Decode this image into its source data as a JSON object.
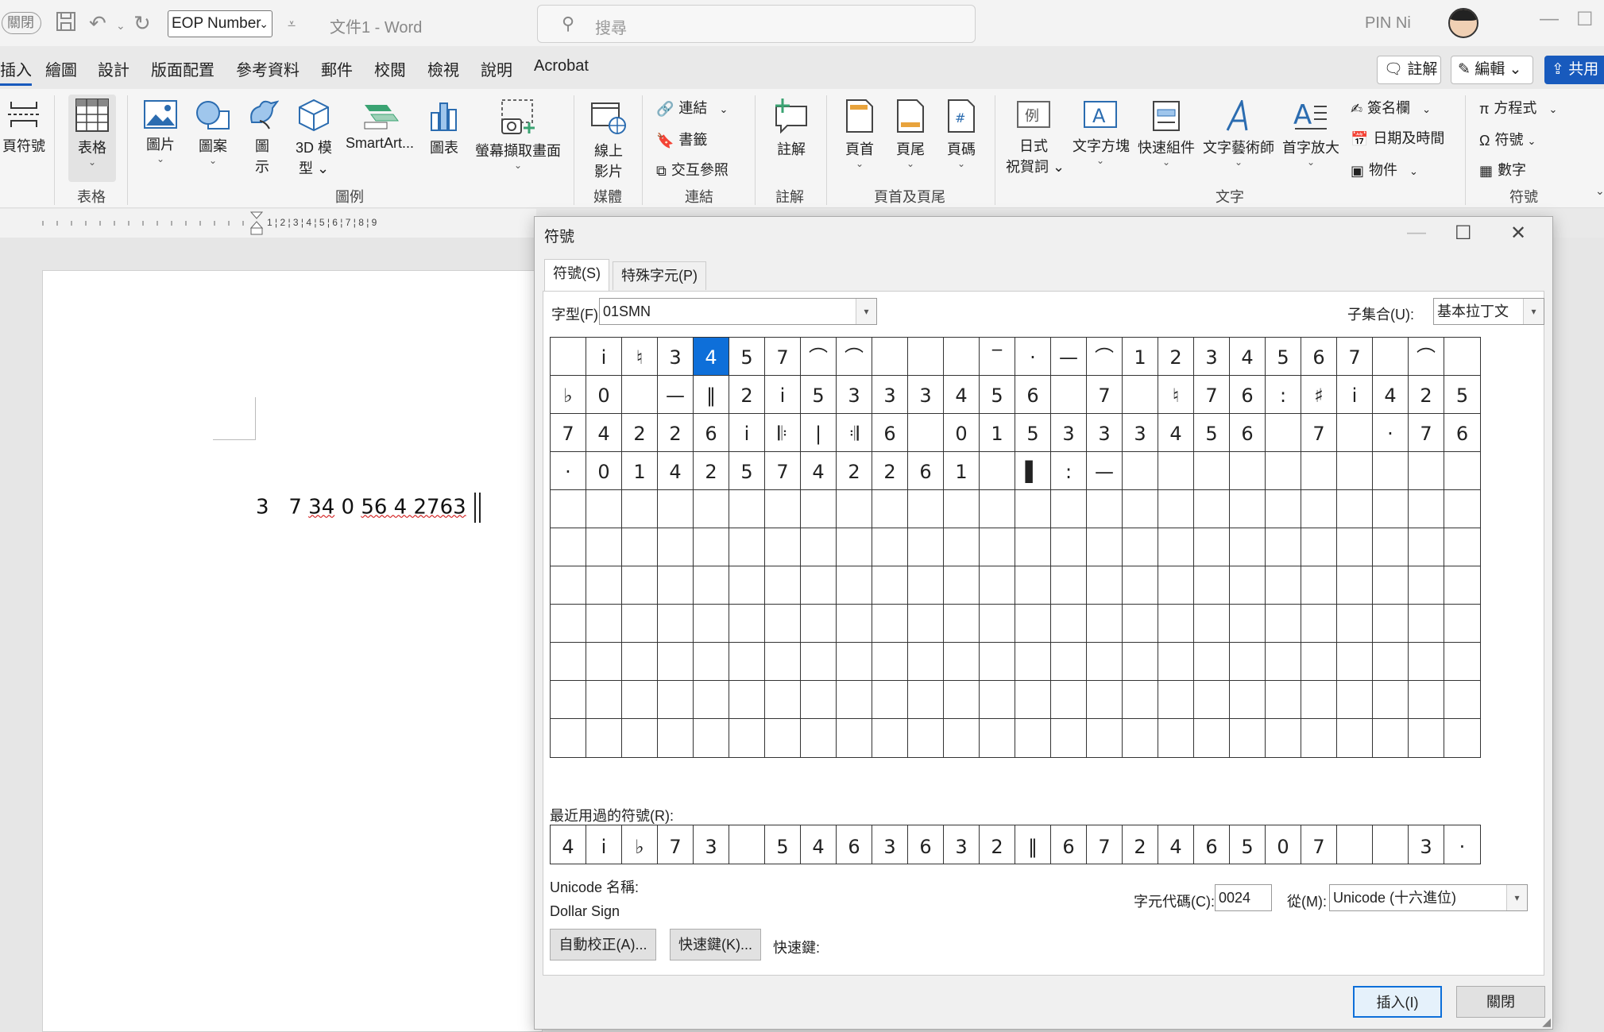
{
  "titlebar": {
    "autosave": "關閉",
    "style_value": "EOP Number",
    "doc_title": "文件1  -  Word",
    "search_placeholder": "搜尋",
    "user": "PIN Ni"
  },
  "tabs": [
    {
      "label": "插入"
    },
    {
      "label": "繪圖"
    },
    {
      "label": "設計"
    },
    {
      "label": "版面配置"
    },
    {
      "label": "參考資料"
    },
    {
      "label": "郵件"
    },
    {
      "label": "校閱"
    },
    {
      "label": "檢視"
    },
    {
      "label": "說明"
    },
    {
      "label": "Acrobat"
    }
  ],
  "actions": {
    "comment": "註解",
    "edit": "編輯",
    "share": "共用"
  },
  "ribbon": {
    "pagebreak": "頁符號",
    "table": "表格",
    "picture": "圖片",
    "shapes": "圖案",
    "icons1": "圖",
    "icons2": "示",
    "model1": "3D 模",
    "model2": "型",
    "smartart": "SmartArt...",
    "chart": "圖表",
    "screenshot": "螢幕擷取畫面",
    "video1": "線上",
    "video2": "影片",
    "link": "連結",
    "bookmark": "書籤",
    "crossref": "交互參照",
    "comment": "註解",
    "header": "頁首",
    "footer": "頁尾",
    "pagenum": "頁碼",
    "greeting1": "日式",
    "greeting2": "祝賀詞",
    "textbox": "文字方塊",
    "quickparts": "快速組件",
    "wordart": "文字藝術師",
    "dropcap": "首字放大",
    "signature": "簽名欄",
    "datetime": "日期及時間",
    "object": "物件",
    "equation": "方程式",
    "symbol": "符號",
    "number": "數字",
    "groups": {
      "tables": "表格",
      "illustrations": "圖例",
      "media": "媒體",
      "links": "連結",
      "comments": "註解",
      "headerfooter": "頁首及頁尾",
      "text": "文字",
      "symbols": "符號"
    }
  },
  "ruler_numbers": "1 ¦ 2 ¦ 3 ¦ 4 ¦ 5 ¦ 6 ¦ 7 ¦ 8 ¦ 9",
  "document": {
    "music_a": "3   7 ",
    "music_b": "34",
    "music_c": " 0 ",
    "music_d": "56 4 2763"
  },
  "dialog": {
    "title": "符號",
    "tab_symbols": "符號(S)",
    "tab_special": "特殊字元(P)",
    "font_label": "字型(F):",
    "font_value": "01SMN",
    "subset_label": "子集合(U):",
    "subset_value": "基本拉丁文",
    "grid": [
      [
        "",
        "i",
        "♮",
        "3",
        "4",
        "5",
        "7",
        "⌒",
        "⌒",
        "",
        "",
        "",
        "‾",
        "·",
        "—",
        "⌒",
        "1",
        "2",
        "3",
        "4",
        "5",
        "6",
        "7",
        "",
        "⌒",
        ""
      ],
      [
        "♭",
        "0",
        "",
        "—",
        "‖",
        "2",
        "i",
        "5",
        "3",
        "3",
        "3",
        "4",
        "5",
        "6",
        "",
        "7",
        "",
        "♮",
        "7",
        "6",
        ":",
        "♯",
        "i",
        "4",
        "2",
        "5"
      ],
      [
        "7",
        "4",
        "2",
        "2",
        "6",
        "i",
        "𝄆",
        "|",
        "𝄇",
        "6",
        "",
        "0",
        "1",
        "5",
        "3",
        "3",
        "3",
        "4",
        "5",
        "6",
        "",
        "7",
        "",
        "·",
        "7",
        "6"
      ],
      [
        "·",
        "0",
        "1",
        "4",
        "2",
        "5",
        "7",
        "4",
        "2",
        "2",
        "6",
        "1",
        "",
        "▌",
        ":",
        "—",
        "",
        "",
        "",
        "",
        "",
        "",
        "",
        "",
        "",
        ""
      ]
    ],
    "selected_symbol": "4",
    "recent_label": "最近用過的符號(R):",
    "recent": [
      "4",
      "i",
      "♭",
      "7",
      "3",
      "",
      "5",
      "4",
      "6",
      "3",
      "6",
      "3",
      "2",
      "‖",
      "6",
      "7",
      "2",
      "4",
      "6",
      "5",
      "0",
      "7",
      "",
      "",
      "3",
      "·"
    ],
    "unicode_name_label": "Unicode 名稱:",
    "unicode_name": "Dollar Sign",
    "charcode_label": "字元代碼(C):",
    "charcode_value": "0024",
    "from_label": "從(M):",
    "from_value": "Unicode (十六進位)",
    "autocorrect_button": "自動校正(A)...",
    "shortcut_button": "快速鍵(K)...",
    "shortcut_label": "快速鍵:",
    "insert_button": "插入(I)",
    "close_button": "關閉"
  }
}
